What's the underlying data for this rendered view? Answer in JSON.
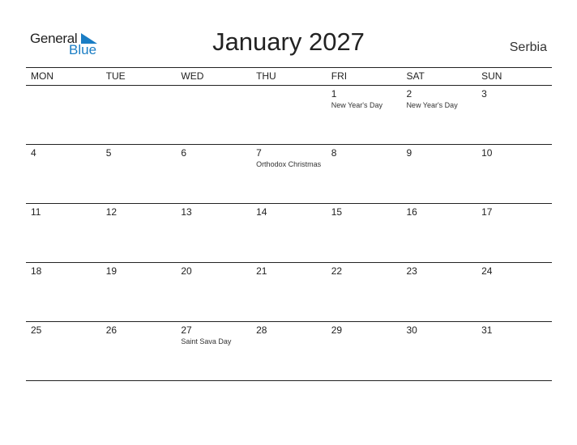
{
  "logo": {
    "general": "General",
    "blue": "Blue",
    "brand_color": "#1a7dc4"
  },
  "title": "January 2027",
  "country": "Serbia",
  "weekdays": [
    "MON",
    "TUE",
    "WED",
    "THU",
    "FRI",
    "SAT",
    "SUN"
  ],
  "weeks": [
    [
      {
        "day": "",
        "holiday": ""
      },
      {
        "day": "",
        "holiday": ""
      },
      {
        "day": "",
        "holiday": ""
      },
      {
        "day": "",
        "holiday": ""
      },
      {
        "day": "1",
        "holiday": "New Year's Day"
      },
      {
        "day": "2",
        "holiday": "New Year's Day"
      },
      {
        "day": "3",
        "holiday": ""
      }
    ],
    [
      {
        "day": "4",
        "holiday": ""
      },
      {
        "day": "5",
        "holiday": ""
      },
      {
        "day": "6",
        "holiday": ""
      },
      {
        "day": "7",
        "holiday": "Orthodox Christmas"
      },
      {
        "day": "8",
        "holiday": ""
      },
      {
        "day": "9",
        "holiday": ""
      },
      {
        "day": "10",
        "holiday": ""
      }
    ],
    [
      {
        "day": "11",
        "holiday": ""
      },
      {
        "day": "12",
        "holiday": ""
      },
      {
        "day": "13",
        "holiday": ""
      },
      {
        "day": "14",
        "holiday": ""
      },
      {
        "day": "15",
        "holiday": ""
      },
      {
        "day": "16",
        "holiday": ""
      },
      {
        "day": "17",
        "holiday": ""
      }
    ],
    [
      {
        "day": "18",
        "holiday": ""
      },
      {
        "day": "19",
        "holiday": ""
      },
      {
        "day": "20",
        "holiday": ""
      },
      {
        "day": "21",
        "holiday": ""
      },
      {
        "day": "22",
        "holiday": ""
      },
      {
        "day": "23",
        "holiday": ""
      },
      {
        "day": "24",
        "holiday": ""
      }
    ],
    [
      {
        "day": "25",
        "holiday": ""
      },
      {
        "day": "26",
        "holiday": ""
      },
      {
        "day": "27",
        "holiday": "Saint Sava Day"
      },
      {
        "day": "28",
        "holiday": ""
      },
      {
        "day": "29",
        "holiday": ""
      },
      {
        "day": "30",
        "holiday": ""
      },
      {
        "day": "31",
        "holiday": ""
      }
    ]
  ]
}
